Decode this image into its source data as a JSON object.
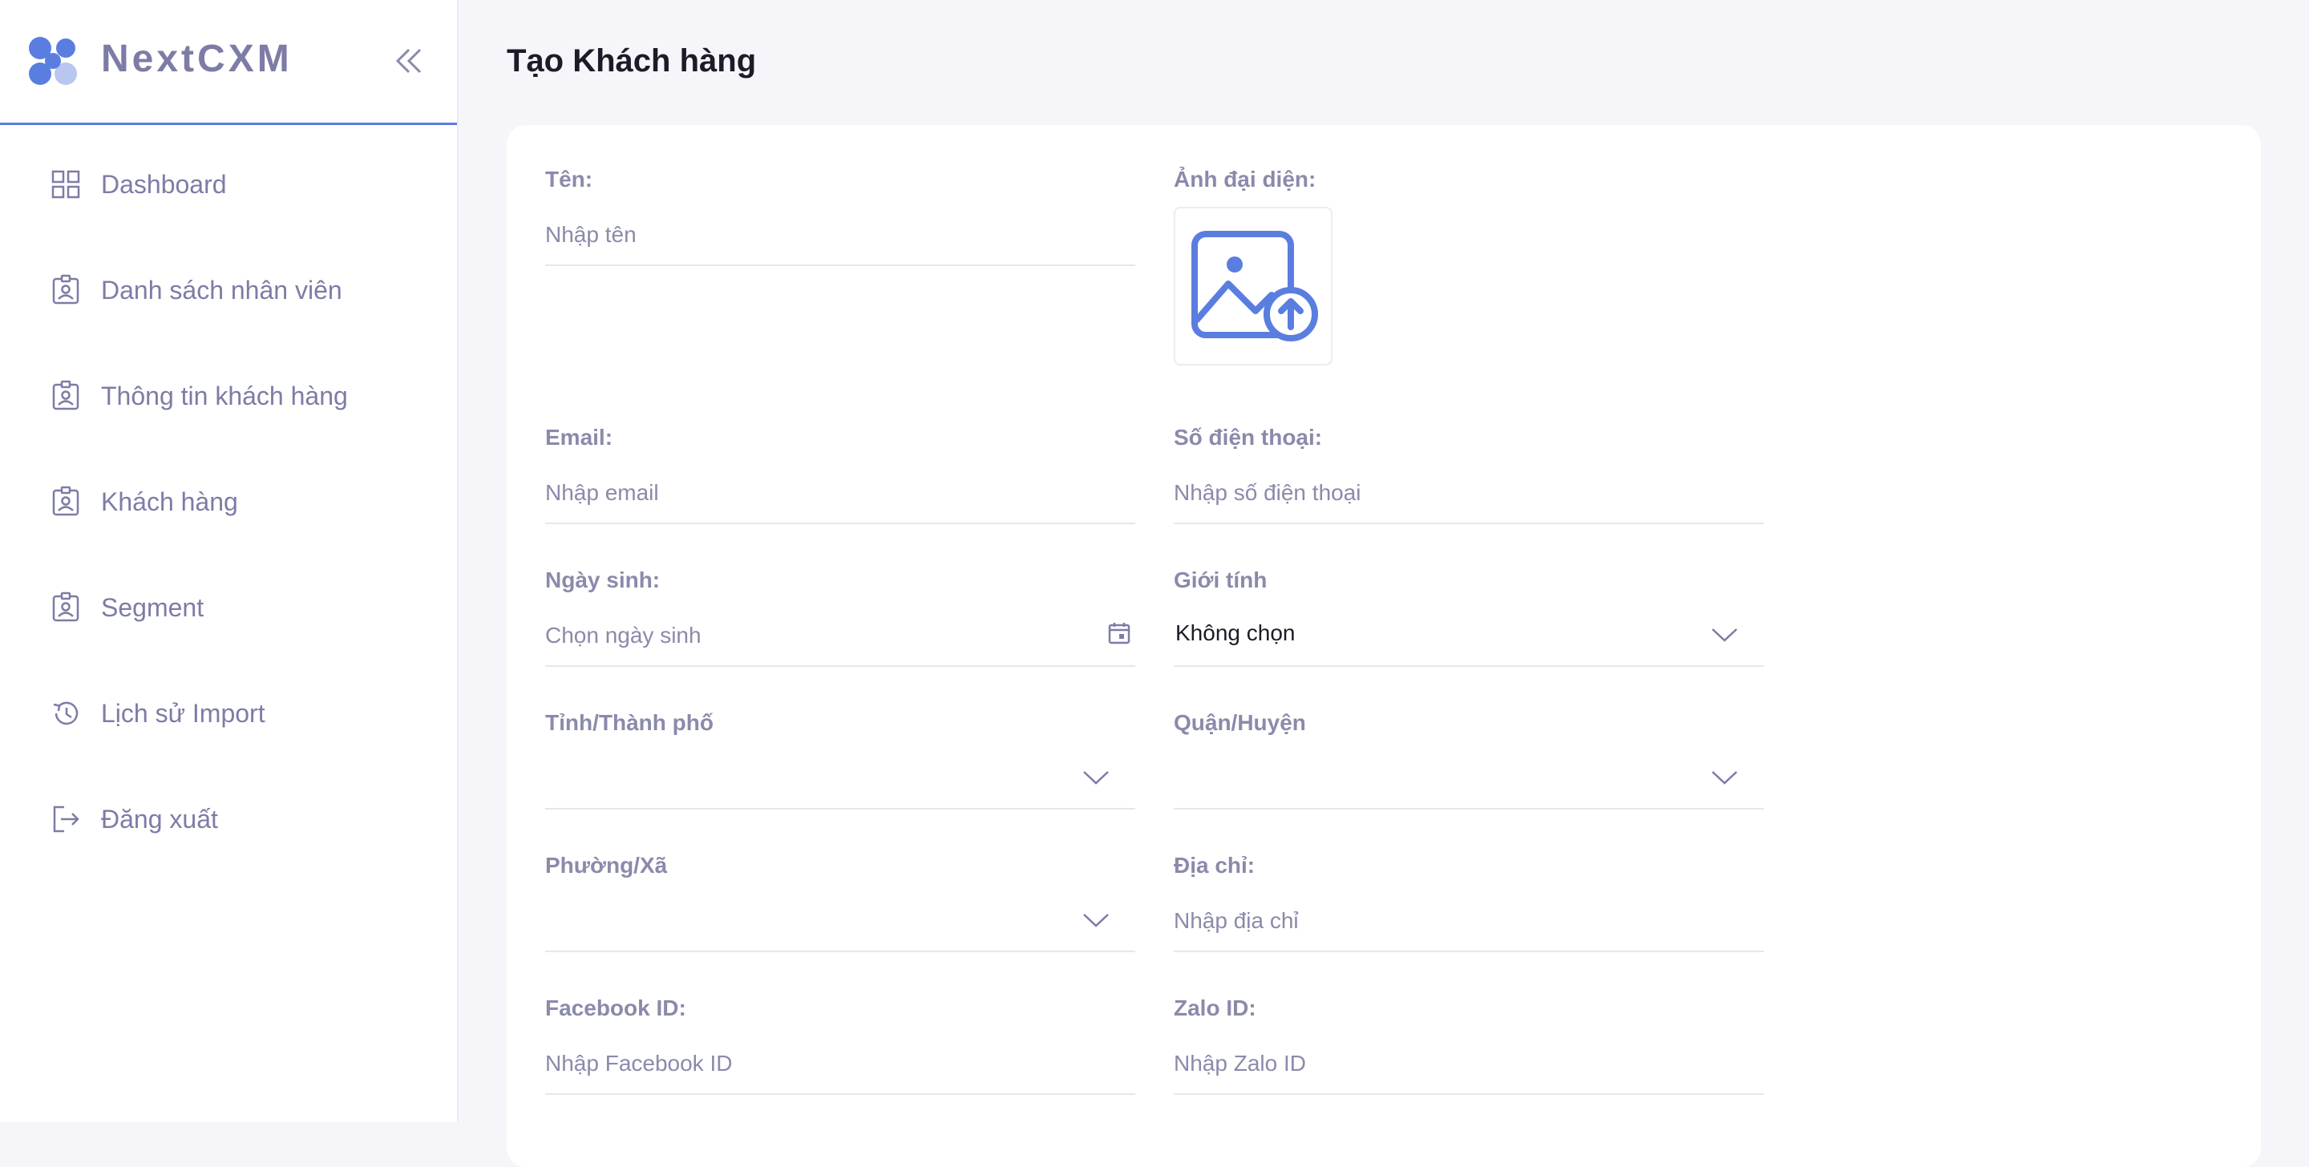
{
  "brand": {
    "name": "NextCXM"
  },
  "sidebar": {
    "items": [
      {
        "label": "Dashboard",
        "icon": "grid-icon"
      },
      {
        "label": "Danh sách nhân viên",
        "icon": "badge-icon"
      },
      {
        "label": "Thông tin khách hàng",
        "icon": "badge-icon"
      },
      {
        "label": "Khách hàng",
        "icon": "badge-icon"
      },
      {
        "label": "Segment",
        "icon": "badge-icon"
      },
      {
        "label": "Lịch sử Import",
        "icon": "history-icon"
      },
      {
        "label": "Đăng xuất",
        "icon": "logout-icon"
      }
    ]
  },
  "page": {
    "title": "Tạo Khách hàng"
  },
  "form": {
    "name": {
      "label": "Tên:",
      "placeholder": "Nhập tên"
    },
    "avatar": {
      "label": "Ảnh đại diện:"
    },
    "email": {
      "label": "Email:",
      "placeholder": "Nhập email"
    },
    "phone": {
      "label": "Số điện thoại:",
      "placeholder": "Nhập số điện thoại"
    },
    "birthday": {
      "label": "Ngày sinh:",
      "placeholder": "Chọn ngày sinh"
    },
    "gender": {
      "label": "Giới tính",
      "value": "Không chọn"
    },
    "province": {
      "label": "Tỉnh/Thành phố",
      "value": ""
    },
    "district": {
      "label": "Quận/Huyện",
      "value": ""
    },
    "ward": {
      "label": "Phường/Xã",
      "value": ""
    },
    "address": {
      "label": "Địa chỉ:",
      "placeholder": "Nhập địa chỉ"
    },
    "facebook": {
      "label": "Facebook ID:",
      "placeholder": "Nhập Facebook ID"
    },
    "zalo": {
      "label": "Zalo ID:",
      "placeholder": "Nhập Zalo ID"
    }
  },
  "colors": {
    "accent": "#5a7de0",
    "muted_text": "#7c7ca6",
    "background": "#f5f5fa"
  }
}
